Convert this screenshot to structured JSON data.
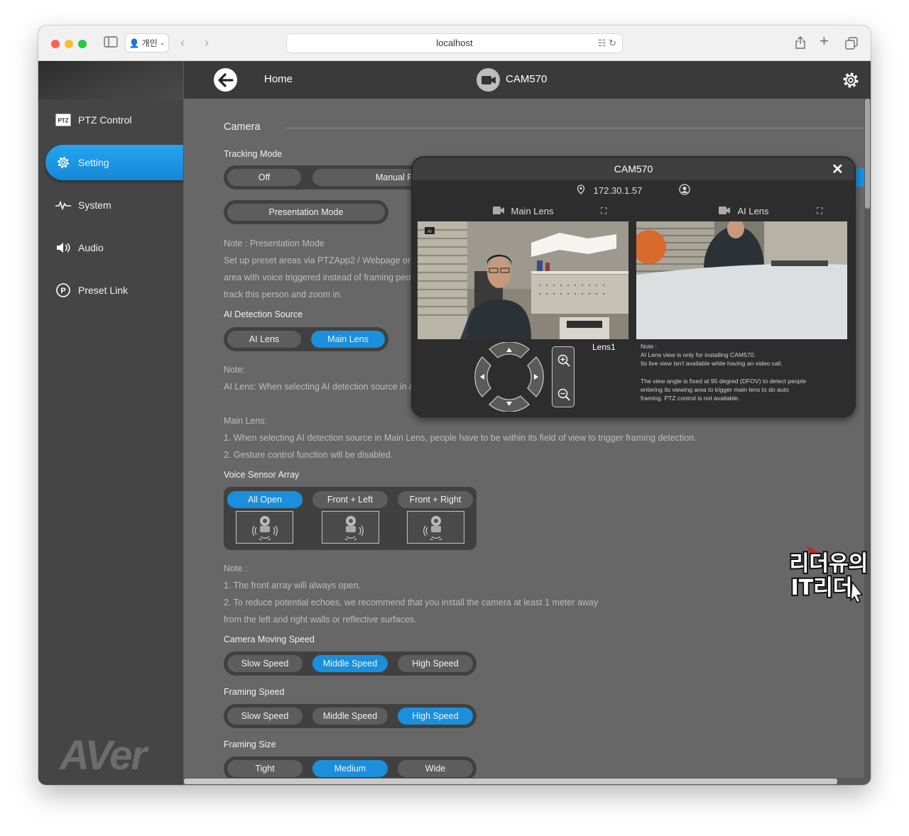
{
  "browser": {
    "profile_label": "개인",
    "url": "localhost"
  },
  "sidebar": {
    "items": [
      {
        "label": "PTZ Control",
        "icon": "ptz-icon"
      },
      {
        "label": "Setting",
        "icon": "gear-icon"
      },
      {
        "label": "System",
        "icon": "pulse-icon"
      },
      {
        "label": "Audio",
        "icon": "speaker-icon"
      },
      {
        "label": "Preset Link",
        "icon": "preset-p-icon"
      }
    ],
    "active": "Setting",
    "logo_text": "AVer"
  },
  "topbar": {
    "home_label": "Home",
    "camera_name": "CAM570"
  },
  "settings": {
    "section_title": "Camera",
    "tracking_mode": {
      "label": "Tracking Mode",
      "options": [
        "Off",
        "Manual Framing"
      ],
      "presentation_button": "Presentation Mode",
      "note_lines": [
        "Note : Presentation Mode",
        "Set up preset areas via PTZApp2 / Webpage or",
        "area with voice triggered instead of framing peo",
        "track this person and zoom in."
      ]
    },
    "ai_detection": {
      "label": "AI Detection Source",
      "options": [
        "AI Lens",
        "Main Lens"
      ],
      "selected": "Main Lens",
      "note_lines": [
        "Note:",
        "AI Lens: When selecting AI detection source in A",
        "",
        "Main Lens:",
        "1. When selecting AI detection source in Main Lens, people have to be within its field of view to trigger framing detection.",
        "2. Gesture control function will be disabled."
      ]
    },
    "voice_sensor": {
      "label": "Voice Sensor Array",
      "options": [
        "All Open",
        "Front + Left",
        "Front + Right"
      ],
      "selected": "All Open",
      "note_lines": [
        "Note :",
        "1. The front array will always open.",
        "2. To reduce potential echoes, we recommend that you install the camera at least 1 meter away",
        "from the left and right walls or reflective surfaces."
      ]
    },
    "camera_moving_speed": {
      "label": "Camera Moving Speed",
      "options": [
        "Slow Speed",
        "Middle Speed",
        "High Speed"
      ],
      "selected": "Middle Speed"
    },
    "framing_speed": {
      "label": "Framing Speed",
      "options": [
        "Slow Speed",
        "Middle Speed",
        "High Speed"
      ],
      "selected": "High Speed"
    },
    "framing_size": {
      "label": "Framing Size",
      "options": [
        "Tight",
        "Medium",
        "Wide"
      ],
      "selected": "Medium"
    }
  },
  "popup": {
    "title": "CAM570",
    "ip": "172.30.1.57",
    "main_lens_label": "Main Lens",
    "ai_lens_label": "AI Lens",
    "lens_tag": "Lens1",
    "note_lines": [
      "Note :",
      "AI Lens view is only for installing CAM570.",
      "Its live view isn't available while having an video call.",
      "",
      "The view angle is fixed at 95 degred (DFOV) to detect people",
      "entering its viewing area to trigger main lens to do auto",
      "framing. PTZ control is not available."
    ]
  },
  "watermark": {
    "line1": "리더유의",
    "line2": "IT리더"
  },
  "colors": {
    "accent": "#1b8fdc",
    "sidebar_bg": "#454545",
    "content_bg": "#676767",
    "topbar_bg": "#3a3a3a"
  }
}
